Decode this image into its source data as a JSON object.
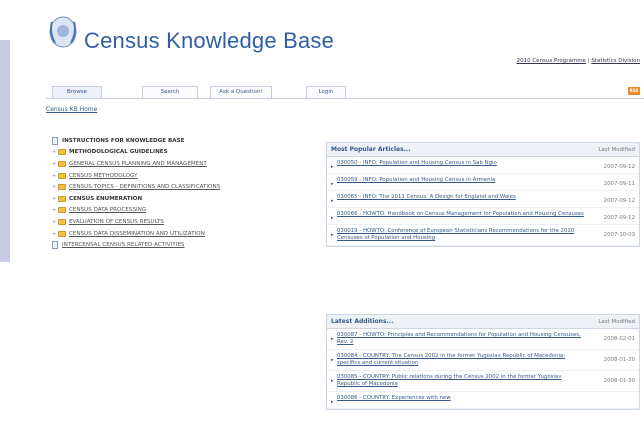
{
  "header": {
    "title": "Census Knowledge Base",
    "top_links": [
      "2010 Census Programme",
      "Statistics Division"
    ],
    "separator": "|"
  },
  "tabs": [
    {
      "label": "Browse"
    },
    {
      "label": "Search"
    },
    {
      "label": "Ask a Question!"
    },
    {
      "label": "Login"
    }
  ],
  "rss_label": "RSS",
  "breadcrumb": "Census KB Home",
  "tree": [
    {
      "label": "INSTRUCTIONS FOR KNOWLEDGE BASE",
      "kind": "doc",
      "bold": true
    },
    {
      "label": "METHODOLOGICAL GUIDELINES",
      "kind": "folder",
      "bold": true
    },
    {
      "label": "GENERAL CENSUS PLANNING AND MANAGEMENT",
      "kind": "folder",
      "bold": false
    },
    {
      "label": "CENSUS METHODOLOGY",
      "kind": "folder",
      "bold": false
    },
    {
      "label": "CENSUS TOPICS - DEFINITIONS AND CLASSIFICATIONS",
      "kind": "folder",
      "bold": false
    },
    {
      "label": "CENSUS ENUMERATION",
      "kind": "folder",
      "bold": true
    },
    {
      "label": "CENSUS DATA PROCESSING",
      "kind": "folder",
      "bold": false
    },
    {
      "label": "EVALUATION OF CENSUS RESULTS",
      "kind": "folder",
      "bold": false
    },
    {
      "label": "CENSUS DATA DISSEMINATION AND UTILIZATION",
      "kind": "folder",
      "bold": false
    },
    {
      "label": "INTERCENSAL CENSUS RELATED ACTIVITIES",
      "kind": "doc",
      "bold": false
    }
  ],
  "popular": {
    "title": "Most Popular Articles...",
    "right_label": "Last Modified",
    "rows": [
      {
        "text": "030050 - INFO: Population and Housing Census in Sab Ngio",
        "date": "2007-09-12"
      },
      {
        "text": "030059 - INFO: Population and Housing Census in Armenia",
        "date": "2007-09-11"
      },
      {
        "text": "030065 - INFO: The 2011 Census: A Design for England and Wales",
        "date": "2007-09-12"
      },
      {
        "text": "030066 - HOWTO: Handbook on Census Management for Population and Housing Censuses",
        "date": "2007-09-12"
      },
      {
        "text": "030019 - HOWTO: Conference of European Statisticians Recommendations for the 2010 Censuses of Population and Housing",
        "date": "2007-10-03"
      }
    ]
  },
  "additions": {
    "title": "Latest Additions...",
    "right_label": "Last Modified",
    "rows": [
      {
        "text": "030087 - HOWTO: Principles and Recommendations for Population and Housing Censuses, Rev. 2",
        "date": "2008-02-01"
      },
      {
        "text": "030084 - COUNTRY: The Census 2002 in the former Yugoslav Republic of Macedonia: specifics and current situation",
        "date": "2008-01-30"
      },
      {
        "text": "030085 - COUNTRY: Public relations during the Census 2002 in the former Yugoslav Republic of Macedonia",
        "date": "2008-01-30"
      },
      {
        "text": "030086 - COUNTRY: Experiences with new",
        "date": ""
      }
    ]
  }
}
